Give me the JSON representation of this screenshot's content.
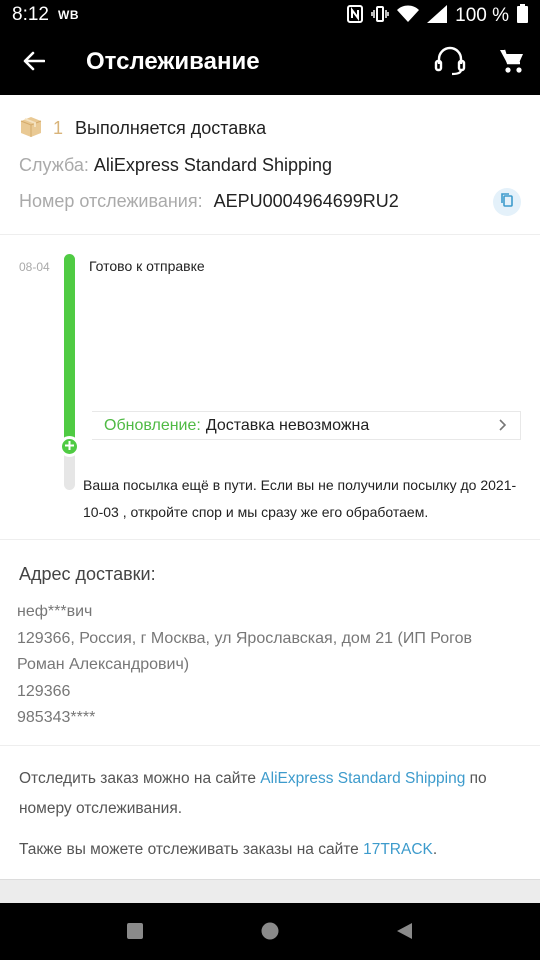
{
  "status_bar": {
    "time": "8:12",
    "carrier_tag": "WB",
    "battery": "100 %"
  },
  "app_bar": {
    "title": "Отслеживание",
    "icons": [
      "back-arrow-icon",
      "headset-support-icon",
      "cart-icon"
    ]
  },
  "shipment": {
    "package_count": "1",
    "status": "Выполняется доставка",
    "service_label": "Служба:",
    "service_value": "AliExpress Standard Shipping",
    "tracking_label": "Номер отслеживания:",
    "tracking_value": "AEPU0004964699RU2"
  },
  "timeline": {
    "events": [
      {
        "date": "08-04",
        "text": "Готово к отправке"
      }
    ],
    "update_label": "Обновление:",
    "update_value": "Доставка невозможна",
    "note": "Ваша посылка ещё в пути. Если вы не получили посылку до 2021-10-03 , откройте спор и мы сразу же его обработаем."
  },
  "address": {
    "title": "Адрес доставки:",
    "name": "неф***вич",
    "street": "129366,  Россия, г Москва, ул Ярославская, дом 21 (ИП Рогов Роман Александрович)",
    "zip": "129366",
    "phone": "985343****"
  },
  "links": {
    "p1_before": "Отследить заказ можно на сайте ",
    "p1_link": "AliExpress Standard Shipping",
    "p1_after": " по номеру отслеживания.",
    "p2_before": "Также вы можете отслеживать заказы на сайте ",
    "p2_link": "17TRACK",
    "p2_after": "."
  },
  "colors": {
    "accent_green": "#4fcb43",
    "link_blue": "#3d9bcc",
    "package_tan": "#d9b47a"
  }
}
